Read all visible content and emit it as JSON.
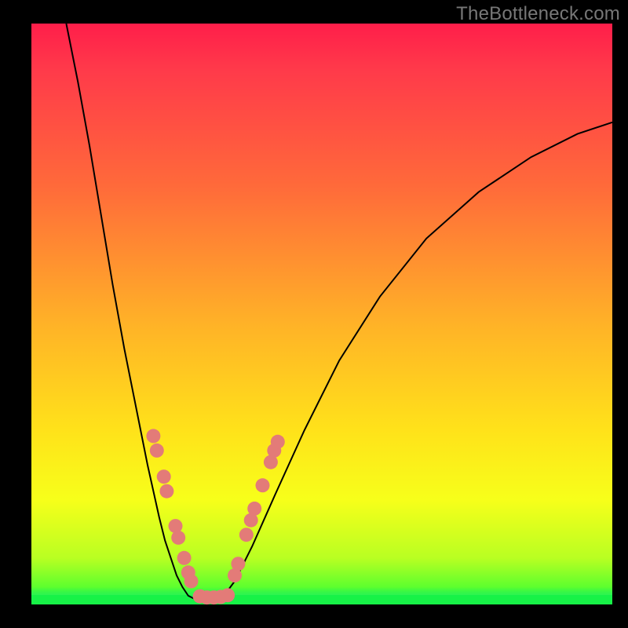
{
  "watermark": "TheBottleneck.com",
  "colors": {
    "bg_black": "#000000",
    "gradient_css": "linear-gradient(to bottom, #ff1e4a 0%, #ff3a4a 8%, #ff6a3a 28%, #ffb327 52%, #ffe21a 70%, #f7ff1a 82%, #b9ff22 92%, #5dff2e 97%, #17f247 100%)",
    "curve": "#000000",
    "marker": "#e37b78",
    "green_solid": "#17f247"
  },
  "chart_data": {
    "type": "line",
    "title": "",
    "xlabel": "",
    "ylabel": "",
    "xlim": [
      0,
      100
    ],
    "ylim": [
      0,
      100
    ],
    "grid": false,
    "legend": false,
    "note": "Axes are unlabeled in the source image — x/y units unknown. Values below are percent-of-plot estimates read off the pixels (0 = left/bottom, 100 = right/top).",
    "series": [
      {
        "name": "bottleneck-curve-left",
        "x": [
          6,
          8,
          10,
          12,
          14,
          16,
          18,
          20,
          22,
          23,
          24,
          25,
          26,
          27
        ],
        "y": [
          100,
          90,
          79,
          67,
          55,
          44,
          34,
          24,
          15,
          11,
          8,
          5,
          3,
          1.5
        ]
      },
      {
        "name": "bottleneck-curve-floor",
        "x": [
          27,
          28,
          29,
          30,
          31,
          32,
          33
        ],
        "y": [
          1.5,
          1,
          0.8,
          0.8,
          0.8,
          1,
          1.3
        ]
      },
      {
        "name": "bottleneck-curve-right",
        "x": [
          33,
          35,
          38,
          42,
          47,
          53,
          60,
          68,
          77,
          86,
          94,
          100
        ],
        "y": [
          1.3,
          4,
          10,
          19,
          30,
          42,
          53,
          63,
          71,
          77,
          81,
          83
        ]
      }
    ],
    "markers": {
      "name": "highlighted-points",
      "points": [
        {
          "x": 21.0,
          "y": 29.0
        },
        {
          "x": 21.6,
          "y": 26.5
        },
        {
          "x": 22.8,
          "y": 22.0
        },
        {
          "x": 23.3,
          "y": 19.5
        },
        {
          "x": 24.8,
          "y": 13.5
        },
        {
          "x": 25.3,
          "y": 11.5
        },
        {
          "x": 26.3,
          "y": 8.0
        },
        {
          "x": 27.0,
          "y": 5.5
        },
        {
          "x": 27.5,
          "y": 4.0
        },
        {
          "x": 29.0,
          "y": 1.4
        },
        {
          "x": 30.2,
          "y": 1.2
        },
        {
          "x": 31.4,
          "y": 1.2
        },
        {
          "x": 32.6,
          "y": 1.3
        },
        {
          "x": 33.8,
          "y": 1.6
        },
        {
          "x": 35.0,
          "y": 5.0
        },
        {
          "x": 35.6,
          "y": 7.0
        },
        {
          "x": 37.0,
          "y": 12.0
        },
        {
          "x": 37.8,
          "y": 14.5
        },
        {
          "x": 38.4,
          "y": 16.5
        },
        {
          "x": 39.8,
          "y": 20.5
        },
        {
          "x": 41.2,
          "y": 24.5
        },
        {
          "x": 41.8,
          "y": 26.5
        },
        {
          "x": 42.4,
          "y": 28.0
        }
      ]
    }
  }
}
